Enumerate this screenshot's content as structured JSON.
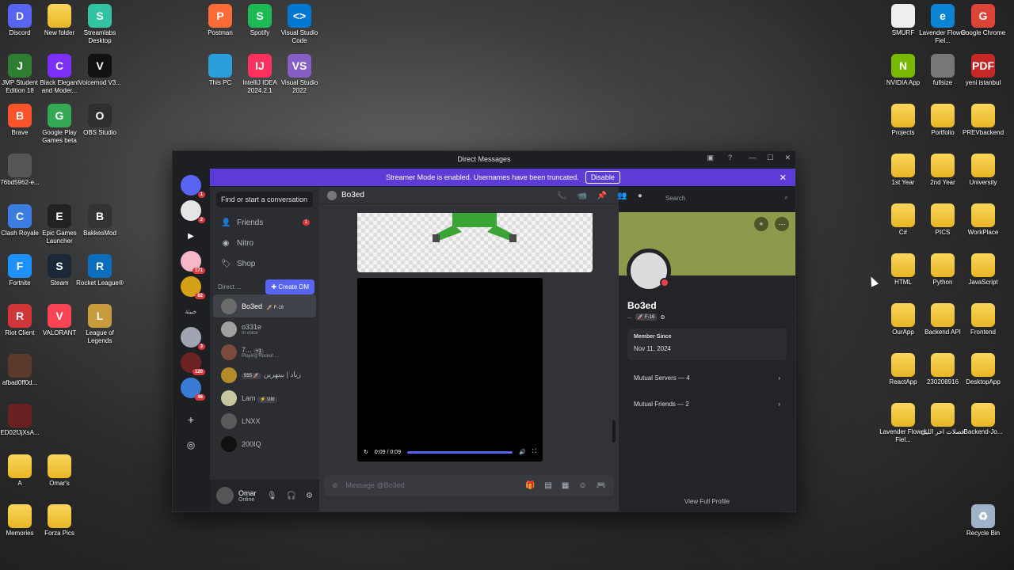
{
  "desktop": {
    "left_icons": [
      {
        "label": "Discord",
        "color": "#5865f2",
        "glyph": "D"
      },
      {
        "label": "New folder",
        "color": "",
        "glyph": ""
      },
      {
        "label": "Streamlabs Desktop",
        "color": "#31c3a2",
        "glyph": "S"
      },
      {
        "label": "JMP Student Edition 18",
        "color": "#2e7d32",
        "glyph": "J"
      },
      {
        "label": "Black Elegant and Moder...",
        "color": "#7b2ff7",
        "glyph": "C"
      },
      {
        "label": "Voicemod V3...",
        "color": "#111111",
        "glyph": "V"
      },
      {
        "label": "Brave",
        "color": "#fb542b",
        "glyph": "B"
      },
      {
        "label": "Google Play Games beta",
        "color": "#34a853",
        "glyph": "G"
      },
      {
        "label": "OBS Studio",
        "color": "#302e31",
        "glyph": "O"
      },
      {
        "label": "76bd5962-e...",
        "color": "#555555",
        "glyph": ""
      },
      {
        "label": "Clash Royale",
        "color": "#3b7de0",
        "glyph": "C"
      },
      {
        "label": "Epic Games Launcher",
        "color": "#222222",
        "glyph": "E"
      },
      {
        "label": "BakkesMod",
        "color": "#333333",
        "glyph": "B"
      },
      {
        "label": "Fortnite",
        "color": "#1e90ff",
        "glyph": "F"
      },
      {
        "label": "Steam",
        "color": "#1b2838",
        "glyph": "S"
      },
      {
        "label": "Rocket League®",
        "color": "#0a6ebd",
        "glyph": "R"
      },
      {
        "label": "Riot Client",
        "color": "#d13639",
        "glyph": "R"
      },
      {
        "label": "VALORANT",
        "color": "#fa4454",
        "glyph": "V"
      },
      {
        "label": "League of Legends",
        "color": "#c89b3c",
        "glyph": "L"
      },
      {
        "label": "afbad0ff0d...",
        "color": "#5a3a2a",
        "glyph": ""
      },
      {
        "label": "ED02fJjXsA...",
        "color": "#6a2020",
        "glyph": ""
      },
      {
        "label": "A",
        "color": "",
        "glyph": ""
      },
      {
        "label": "Omar's",
        "color": "",
        "glyph": ""
      },
      {
        "label": "Memories",
        "color": "",
        "glyph": ""
      },
      {
        "label": "Forza Pics",
        "color": "",
        "glyph": ""
      }
    ],
    "top_icons": [
      {
        "label": "Postman",
        "color": "#ff6c37",
        "glyph": "P"
      },
      {
        "label": "Spotify",
        "color": "#1db954",
        "glyph": "S"
      },
      {
        "label": "Visual Studio Code",
        "color": "#0078d4",
        "glyph": "<>"
      },
      {
        "label": "This PC",
        "color": "#2b9fd9",
        "glyph": ""
      },
      {
        "label": "IntelliJ IDEA 2024.2.1",
        "color": "#fe315d",
        "glyph": "IJ"
      },
      {
        "label": "Visual Studio 2022",
        "color": "#865fc5",
        "glyph": "VS"
      }
    ],
    "right_icons": [
      {
        "label": "SMURF",
        "color": "#eeeeee",
        "glyph": ""
      },
      {
        "label": "Lavender Flower Fiel...",
        "color": "#0b84d6",
        "glyph": "e"
      },
      {
        "label": "Google Chrome",
        "color": "#db4437",
        "glyph": "G"
      },
      {
        "label": "NVIDIA App",
        "color": "#76b900",
        "glyph": "N"
      },
      {
        "label": "fullsize",
        "color": "#777777",
        "glyph": ""
      },
      {
        "label": "yeni istanbul",
        "color": "#c62828",
        "glyph": "PDF"
      },
      {
        "label": "Projects",
        "color": "",
        "glyph": ""
      },
      {
        "label": "Portfolio",
        "color": "",
        "glyph": ""
      },
      {
        "label": "PREVbackend",
        "color": "",
        "glyph": ""
      },
      {
        "label": "1st Year",
        "color": "",
        "glyph": ""
      },
      {
        "label": "2nd Year",
        "color": "",
        "glyph": ""
      },
      {
        "label": "University",
        "color": "",
        "glyph": ""
      },
      {
        "label": "C#",
        "color": "",
        "glyph": ""
      },
      {
        "label": "PICS",
        "color": "",
        "glyph": ""
      },
      {
        "label": "WorkPlace",
        "color": "",
        "glyph": ""
      },
      {
        "label": "HTML",
        "color": "",
        "glyph": ""
      },
      {
        "label": "Python",
        "color": "",
        "glyph": ""
      },
      {
        "label": "JavaScript",
        "color": "",
        "glyph": ""
      },
      {
        "label": "OurApp",
        "color": "",
        "glyph": ""
      },
      {
        "label": "Backend API",
        "color": "",
        "glyph": ""
      },
      {
        "label": "Frontend",
        "color": "",
        "glyph": ""
      },
      {
        "label": "ReactApp",
        "color": "",
        "glyph": ""
      },
      {
        "label": "230208916",
        "color": "",
        "glyph": ""
      },
      {
        "label": "DesktopApp",
        "color": "",
        "glyph": ""
      },
      {
        "label": "Lavender Flower Fiel...",
        "color": "",
        "glyph": ""
      },
      {
        "label": "فصلات اخر الليل",
        "color": "",
        "glyph": ""
      },
      {
        "label": "Backend-Jo...",
        "color": "",
        "glyph": ""
      },
      {
        "label": "Recycle Bin",
        "color": "#9fb3c8",
        "glyph": "♻"
      }
    ]
  },
  "discord": {
    "window_title": "Direct Messages",
    "banner_text": "Streamer Mode is enabled. Usernames have been truncated.",
    "banner_button": "Disable",
    "guild_badges": [
      "1",
      "2",
      "171",
      "82",
      "3",
      "120",
      "46"
    ],
    "guild_text": "خبيثة",
    "search_conversation": "Find or start a conversation",
    "nav": [
      {
        "label": "Friends",
        "icon": "friends-icon",
        "count": "1"
      },
      {
        "label": "Nitro",
        "icon": "nitro-icon",
        "count": ""
      },
      {
        "label": "Shop",
        "icon": "shop-icon",
        "count": ""
      }
    ],
    "dm_header": "Direct ...",
    "create_dm": "Create DM",
    "dms": [
      {
        "name": "Bo3ed",
        "tag": "🚀 F-16",
        "sub": ""
      },
      {
        "name": "o331e",
        "tag": "",
        "sub": "In voice"
      },
      {
        "name": "7...",
        "tag": "+1",
        "sub": "Playing Rocket ..."
      },
      {
        "name": "زياد | بيتهرين",
        "tag": "🚀 555",
        "sub": ""
      },
      {
        "name": "Lam",
        "tag": "⚡ Ultr",
        "sub": ""
      },
      {
        "name": "LNXX",
        "tag": "",
        "sub": ""
      },
      {
        "name": "200IQ",
        "tag": "",
        "sub": ""
      }
    ],
    "user": {
      "name": "Omar",
      "status": "Online"
    },
    "chat_header_name": "Bo3ed",
    "search_placeholder": "Search",
    "video_time": "0:09 / 0:09",
    "video_progress": 1.0,
    "compose_placeholder": "Message @Bo3ed",
    "profile": {
      "name": "Bo3ed",
      "sub_handle": "...",
      "sub_tag": "🚀 F-16",
      "banner_color": "#8c9a4c",
      "member_since_label": "Member Since",
      "member_since": "Nov 11, 2024",
      "mutual_servers": "Mutual Servers — 4",
      "mutual_friends": "Mutual Friends — 2",
      "view_full": "View Full Profile"
    }
  }
}
